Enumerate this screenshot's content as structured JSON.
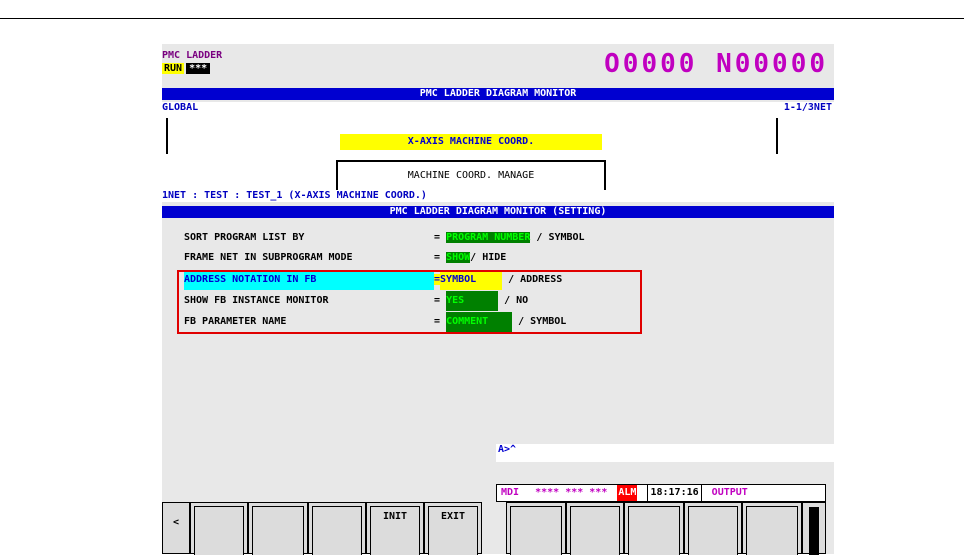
{
  "header": {
    "screen_name": "PMC LADDER",
    "run_label": "RUN",
    "run_status": "***",
    "program_number": "O0000 N00000"
  },
  "monitor": {
    "title": "PMC LADDER DIAGRAM MONITOR",
    "scope": "GLOBAL",
    "net_position": "1-1/3NET",
    "coil_comment": "X-AXIS MACHINE COORD.",
    "fb_name": "MACHINE COORD. MANAGE",
    "net_info": "1NET : TEST : TEST_1 (X-AXIS MACHINE COORD.)"
  },
  "settings": {
    "title": "PMC LADDER DIAGRAM MONITOR (SETTING)",
    "items": [
      {
        "label": "SORT PROGRAM LIST BY",
        "eq": "=",
        "selected": "PROGRAM NUMBER",
        "sep": "/",
        "other": "SYMBOL"
      },
      {
        "label": "FRAME NET IN SUBPROGRAM MODE",
        "eq": "=",
        "selected": "SHOW",
        "sep": "/",
        "other": "HIDE"
      },
      {
        "label": "ADDRESS NOTATION IN FB",
        "eq": "=",
        "selected": "SYMBOL",
        "sep": "/",
        "other": "ADDRESS"
      },
      {
        "label": "SHOW FB INSTANCE MONITOR",
        "eq": "=",
        "selected": "YES",
        "sep": "/",
        "other": "NO"
      },
      {
        "label": "FB PARAMETER NAME",
        "eq": "=",
        "selected": "COMMENT",
        "sep": "/",
        "other": "SYMBOL"
      }
    ]
  },
  "command_line": "A>^",
  "status_bar": {
    "mode": "MDI",
    "stars": "**** *** ***",
    "alarm": "ALM",
    "time": "18:17:16",
    "output": "OUTPUT"
  },
  "softkeys": {
    "prev": "<",
    "init": "INIT",
    "exit": "EXIT"
  }
}
